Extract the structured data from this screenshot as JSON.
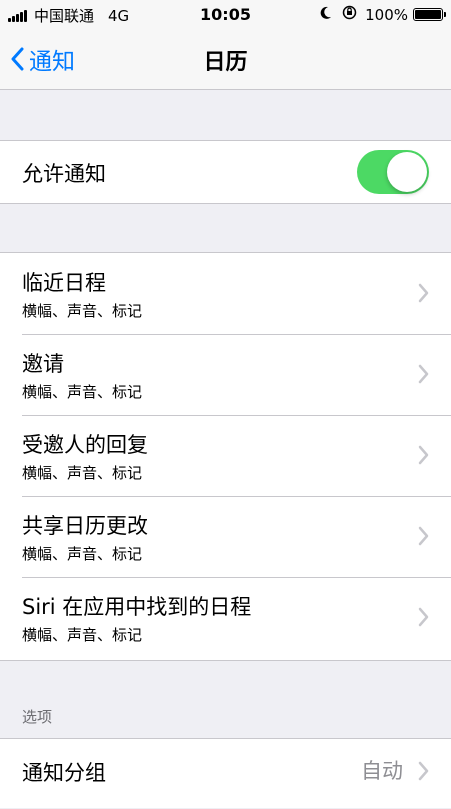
{
  "status_bar": {
    "carrier": "中国联通",
    "network": "4G",
    "time": "10:05",
    "battery": "100%"
  },
  "nav": {
    "back_label": "通知",
    "title": "日历"
  },
  "allow_notifications": {
    "label": "允许通知",
    "enabled": true
  },
  "items": [
    {
      "title": "临近日程",
      "subtitle": "横幅、声音、标记"
    },
    {
      "title": "邀请",
      "subtitle": "横幅、声音、标记"
    },
    {
      "title": "受邀人的回复",
      "subtitle": "横幅、声音、标记"
    },
    {
      "title": "共享日历更改",
      "subtitle": "横幅、声音、标记"
    },
    {
      "title": "Siri 在应用中找到的日程",
      "subtitle": "横幅、声音、标记"
    }
  ],
  "options_section": {
    "header": "选项",
    "grouping_label": "通知分组",
    "grouping_value": "自动"
  },
  "colors": {
    "accent": "#007aff",
    "toggle_on": "#4cd964",
    "background": "#efeff4"
  }
}
